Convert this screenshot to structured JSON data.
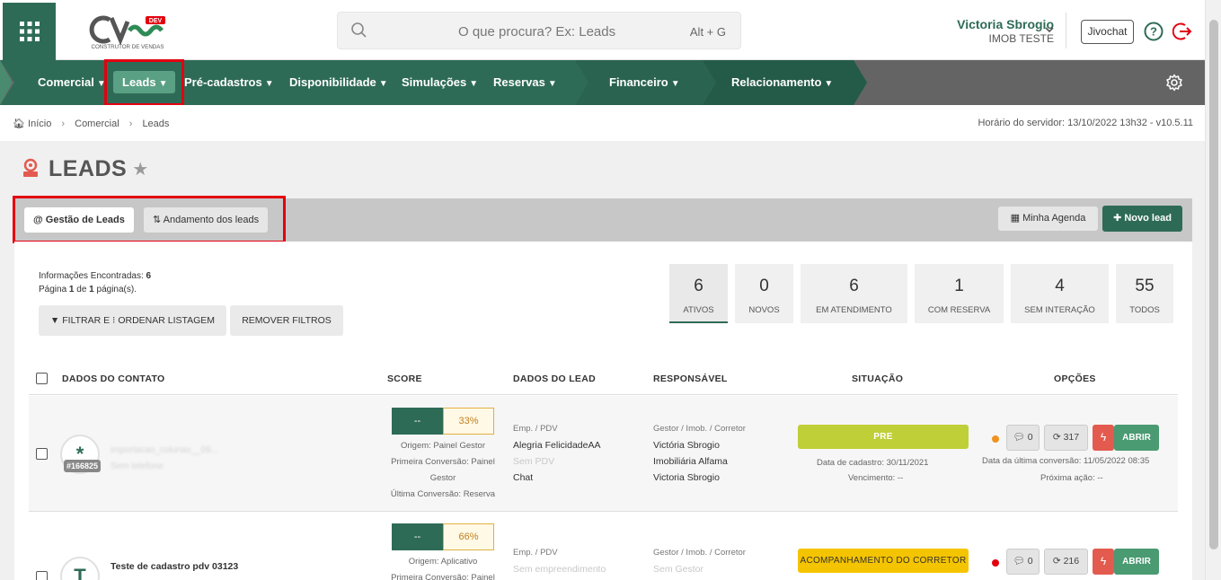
{
  "logo": {
    "tag": "DEV",
    "subtitle": "CONSTRUTOR DE VENDAS"
  },
  "search": {
    "placeholder": "O que procura? Ex: Leads",
    "shortcut": "Alt + G"
  },
  "user": {
    "name": "Victoria Sbrogio",
    "company": "IMOB TESTE"
  },
  "header": {
    "jivochat_label": "Jivochat"
  },
  "nav": {
    "items": [
      {
        "label": "Comercial"
      },
      {
        "label": "Leads"
      },
      {
        "label": "Pré-cadastros"
      },
      {
        "label": "Disponibilidade"
      },
      {
        "label": "Simulações"
      },
      {
        "label": "Reservas"
      },
      {
        "label": "Financeiro"
      },
      {
        "label": "Relacionamento"
      }
    ]
  },
  "breadcrumb": {
    "items": [
      "Início",
      "Comercial",
      "Leads"
    ],
    "server_time": "Horário do servidor: 13/10/2022 13h32 - v10.5.11"
  },
  "page": {
    "title": "LEADS"
  },
  "tabs": {
    "gestao": "@ Gestão de Leads",
    "andamento": "Andamento dos leads"
  },
  "actions": {
    "agenda": "Minha Agenda",
    "new_lead": "Novo lead"
  },
  "info": {
    "line1_prefix": "Informações Encontradas: ",
    "count": "6",
    "page_prefix": "Página ",
    "page_cur": "1",
    "page_mid": " de ",
    "page_total": "1",
    "page_suffix": " página(s)."
  },
  "filters": {
    "filter_label": "FILTRAR E ⁝ ORDENAR LISTAGEM",
    "remove_label": "REMOVER FILTROS"
  },
  "stats": [
    {
      "value": "6",
      "label": "ATIVOS"
    },
    {
      "value": "0",
      "label": "NOVOS"
    },
    {
      "value": "6",
      "label": "EM ATENDIMENTO"
    },
    {
      "value": "1",
      "label": "COM RESERVA"
    },
    {
      "value": "4",
      "label": "SEM INTERAÇÃO"
    },
    {
      "value": "55",
      "label": "TODOS"
    }
  ],
  "table": {
    "headers": {
      "contato": "DADOS DO CONTATO",
      "score": "SCORE",
      "lead": "DADOS DO LEAD",
      "responsavel": "RESPONSÁVEL",
      "situacao": "SITUAÇÃO",
      "opcoes": "OPÇÕES"
    }
  },
  "rows": [
    {
      "avatar": "*",
      "id": "#166825",
      "name": "importacao_colunas__09...",
      "phone": "Sem telefone",
      "score_left": "--",
      "score_pct": "33%",
      "origem": "Origem: Painel Gestor",
      "primeira1": "Primeira Conversão: Painel",
      "primeira2": "Gestor",
      "ultima": "Última Conversão: Reserva",
      "lead_label": "Emp. / PDV",
      "emp": "Alegria FelicidadeAA",
      "pdv": "Sem PDV",
      "canal": "Chat",
      "resp_label": "Gestor / Imob. / Corretor",
      "gestor": "Victória Sbrogio",
      "imob": "Imobiliária Alfama",
      "corretor": "Victoria Sbrogio",
      "status": "PRE",
      "cadastro": "Data de cadastro: 30/11/2021",
      "vencimento": "Vencimento: --",
      "msgs": "0",
      "interacoes": "317",
      "abrir": "ABRIR",
      "ultima_conv": "Data da última conversão: 11/05/2022 08:35",
      "proxima": "Próxima ação: --",
      "dot_color": "#f0921e",
      "status_color": "#bfcf38"
    },
    {
      "avatar": "T",
      "name": "Teste de cadastro pdv 03123",
      "score_left": "--",
      "score_pct": "66%",
      "origem": "Origem: Aplicativo",
      "primeira1": "Primeira Conversão: Painel",
      "lead_label": "Emp. / PDV",
      "emp": "Sem empreendimento",
      "resp_label": "Gestor / Imob. / Corretor",
      "gestor": "Sem Gestor",
      "status": "ACOMPANHAMENTO DO CORRETOR",
      "msgs": "0",
      "interacoes": "216",
      "abrir": "ABRIR",
      "dot_color": "#e3000f",
      "status_color": "#f5c400"
    }
  ],
  "colors": {
    "brand": "#2e6b57",
    "nav_bg": "#646464",
    "highlight": "#e3000f"
  }
}
